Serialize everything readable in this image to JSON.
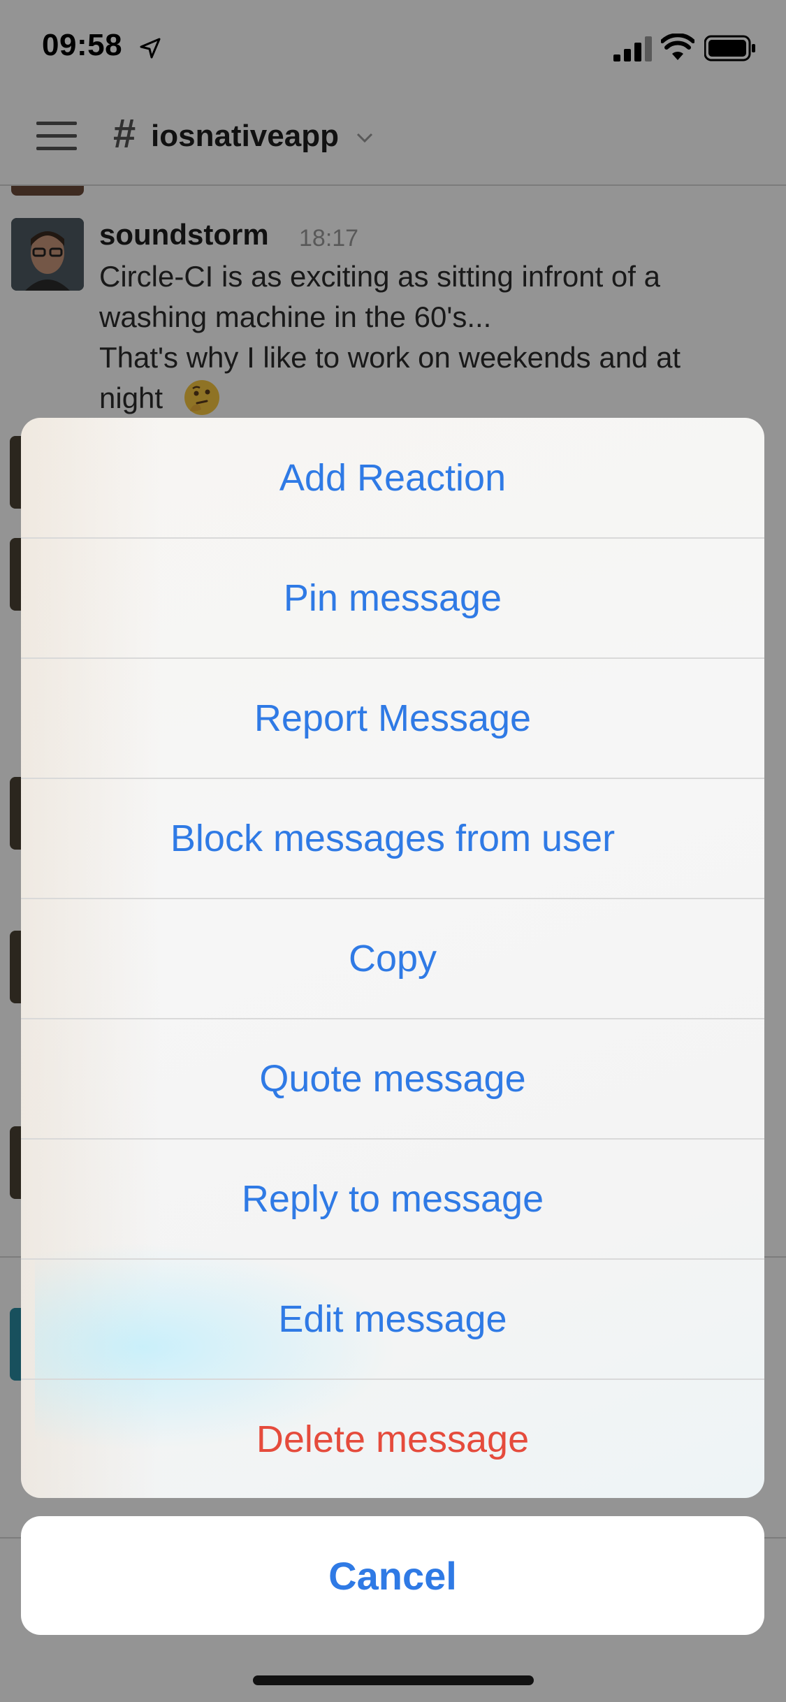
{
  "status_bar": {
    "time": "09:58",
    "icons": [
      "location-arrow-icon",
      "signal-icon",
      "wifi-icon",
      "battery-icon"
    ]
  },
  "header": {
    "hash": "#",
    "channel": "iosnativeapp"
  },
  "message": {
    "author": "soundstorm",
    "time": "18:17",
    "lines": [
      "Circle-CI is as exciting as sitting infront of a",
      "washing machine in the 60's...",
      "That's why I like to work on weekends and at",
      "night"
    ],
    "emoji": "thinking-face"
  },
  "action_sheet": {
    "items": [
      {
        "label": "Add Reaction"
      },
      {
        "label": "Pin message"
      },
      {
        "label": "Report Message"
      },
      {
        "label": "Block messages from user"
      },
      {
        "label": "Copy"
      },
      {
        "label": "Quote message"
      },
      {
        "label": "Reply to message"
      },
      {
        "label": "Edit message"
      },
      {
        "label": "Delete message"
      }
    ],
    "cancel": "Cancel"
  },
  "colors": {
    "action": "#2f7ae5",
    "destructive": "#e54b3c"
  }
}
